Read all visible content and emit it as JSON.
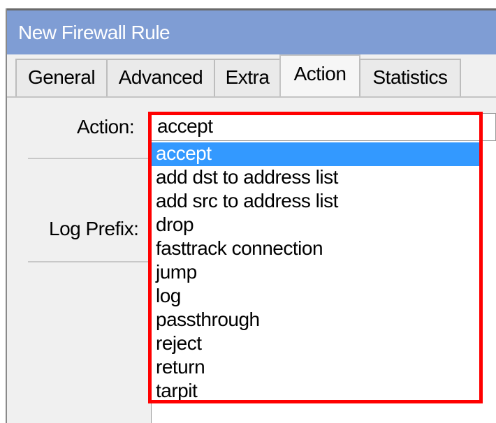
{
  "window": {
    "title": "New Firewall Rule"
  },
  "tabs": [
    {
      "label": "General",
      "active": false
    },
    {
      "label": "Advanced",
      "active": false
    },
    {
      "label": "Extra",
      "active": false
    },
    {
      "label": "Action",
      "active": true
    },
    {
      "label": "Statistics",
      "active": false
    }
  ],
  "form": {
    "action_label": "Action:",
    "action_value": "accept",
    "log_prefix_label": "Log Prefix:"
  },
  "dropdown": {
    "selected": "accept",
    "options": [
      "accept",
      "add dst to address list",
      "add src to address list",
      "drop",
      "fasttrack connection",
      "jump",
      "log",
      "passthrough",
      "reject",
      "return",
      "tarpit"
    ]
  },
  "colors": {
    "titlebar": "#7f9dd4",
    "selection": "#3399ff",
    "annotation": "#ff0000"
  }
}
